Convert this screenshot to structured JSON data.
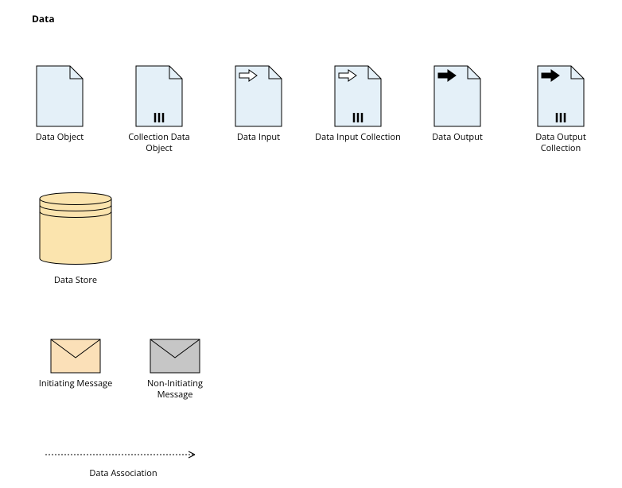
{
  "title": "Data",
  "row1": [
    {
      "label": "Data Object"
    },
    {
      "label": "Collection Data Object"
    },
    {
      "label": "Data Input"
    },
    {
      "label": "Data Input Collection"
    },
    {
      "label": "Data Output"
    },
    {
      "label": "Data Output Collection"
    }
  ],
  "dataStore": {
    "label": "Data Store"
  },
  "messages": [
    {
      "label": "Initiating Message"
    },
    {
      "label": "Non-Initiating Message"
    }
  ],
  "association": {
    "label": "Data Association"
  },
  "colors": {
    "docFill": "#e4f0f8",
    "storeFill": "#fbe4ae",
    "msg1Fill": "#fbe0b8",
    "msg2Fill": "#c6c6c6",
    "stroke": "#000"
  }
}
